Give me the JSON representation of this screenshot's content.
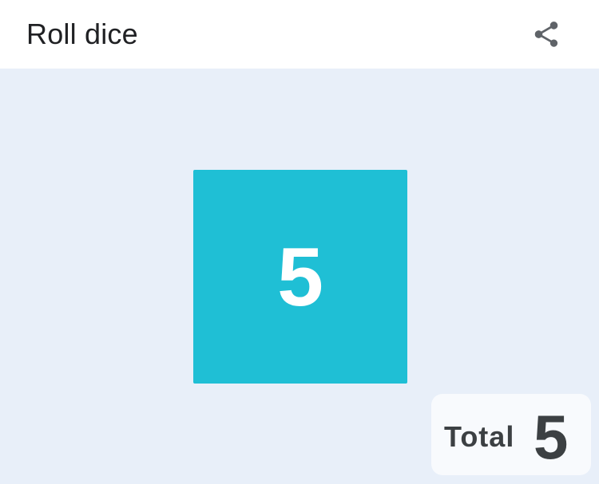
{
  "header": {
    "title": "Roll dice",
    "share_icon": "share-icon"
  },
  "dice": {
    "color": "#1fbfd5",
    "values": [
      "5"
    ]
  },
  "total": {
    "label": "Total",
    "value": "5"
  },
  "colors": {
    "background": "#e8eff9",
    "header_background": "#ffffff",
    "title_text": "#202124",
    "icon": "#5f6368",
    "total_text": "#3c4043"
  }
}
